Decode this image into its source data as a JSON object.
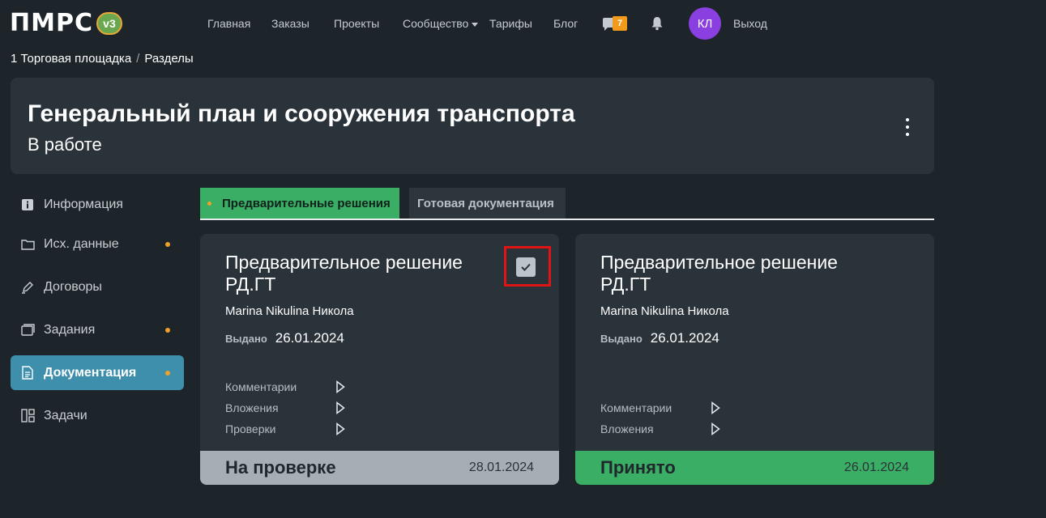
{
  "header": {
    "logo_text": "ПМРС",
    "logo_badge": "v3",
    "nav": [
      "Главная",
      "Заказы",
      "Проекты",
      "Сообщество",
      "Тарифы",
      "Блог"
    ],
    "messages_count": "7",
    "avatar_initials": "КЛ",
    "logout_label": "Выход"
  },
  "breadcrumb": {
    "item1": "1 Торговая площадка",
    "separator": "/",
    "item2": "Разделы"
  },
  "section": {
    "title": "Генеральный план и сооружения транспорта",
    "status": "В работе"
  },
  "sidebar": {
    "items": [
      {
        "label": "Информация",
        "icon": "info-icon",
        "dot": false
      },
      {
        "label": "Исх. данные",
        "icon": "folder-icon",
        "dot": true
      },
      {
        "label": "Договоры",
        "icon": "pen-icon",
        "dot": false
      },
      {
        "label": "Задания",
        "icon": "cards-icon",
        "dot": true
      },
      {
        "label": "Документация",
        "icon": "document-icon",
        "dot": true,
        "active": true
      },
      {
        "label": "Задачи",
        "icon": "board-icon",
        "dot": false
      }
    ]
  },
  "tabs": {
    "active": "Предварительные решения",
    "inactive": "Готовая документация"
  },
  "cards": [
    {
      "title": "Предварительное решение РД.ГТ",
      "author": "Marina Nikulina Никола",
      "issued_label": "Выдано",
      "issued_date": "26.01.2024",
      "links": [
        "Комментарии",
        "Вложения",
        "Проверки"
      ],
      "checked": true,
      "footer_status": "На проверке",
      "footer_date": "28.01.2024",
      "footer_color": "#a6aeb5"
    },
    {
      "title": "Предварительное решение РД.ГТ",
      "author": "Marina Nikulina Никола",
      "issued_label": "Выдано",
      "issued_date": "26.01.2024",
      "links": [
        "Комментарии",
        "Вложения"
      ],
      "footer_status": "Принято",
      "footer_date": "26.01.2024",
      "footer_color": "#3aae65"
    }
  ],
  "colors": {
    "background": "#1d252b",
    "card": "#2a323a",
    "accent_green": "#3aae65",
    "active_sidebar": "#3d8fac",
    "badge_orange": "#f19a1c",
    "highlight_red": "#e01414"
  }
}
